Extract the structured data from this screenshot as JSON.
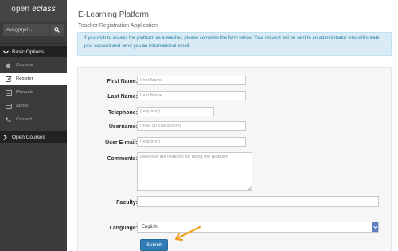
{
  "sidebar": {
    "logo_text": "open ",
    "logo_accent": "eclass",
    "search": {
      "placeholder": "Αναζήτηση...",
      "icon": "search-icon"
    },
    "basic_options": {
      "label": "Basic Options",
      "items": [
        {
          "label": "Courses",
          "icon": "graduation-cap-icon"
        },
        {
          "label": "Register",
          "icon": "edit-icon"
        },
        {
          "label": "Manuals",
          "icon": "book-icon"
        },
        {
          "label": "About",
          "icon": "info-card-icon"
        },
        {
          "label": "Contact",
          "icon": "phone-icon"
        }
      ]
    },
    "open_courses": {
      "label": "Open Courses"
    }
  },
  "main": {
    "title": "E-Learning Platform",
    "subtitle": "Teacher Registration Application",
    "info": "If you wish to access the platform as a teacher, please complete the form below. Your request will be sent to an administrator who will create your account and send you an informational email.",
    "form": {
      "first_name": {
        "label": "First Name:",
        "placeholder": "First Name"
      },
      "last_name": {
        "label": "Last Name:",
        "placeholder": "Last Name"
      },
      "telephone": {
        "label": "Telephone:",
        "placeholder": "(required)"
      },
      "username": {
        "label": "Username:",
        "placeholder": "(max 30 characters)"
      },
      "email": {
        "label": "User E-mail:",
        "placeholder": "(required)"
      },
      "comments": {
        "label": "Comments:",
        "placeholder": "Describe the reasons for using the platform"
      },
      "faculty": {
        "label": "Faculty:",
        "value": ""
      },
      "language": {
        "label": "Language:",
        "value": "English"
      },
      "submit_label": "Submit"
    }
  },
  "colors": {
    "sidebar_bg": "#3b3b3b",
    "group_header_bg": "#222222",
    "info_bg": "#d9ecf5",
    "info_text": "#2a7ba3",
    "submit_bg": "#2f7bb3",
    "annotation_arrow": "#f0a020"
  }
}
